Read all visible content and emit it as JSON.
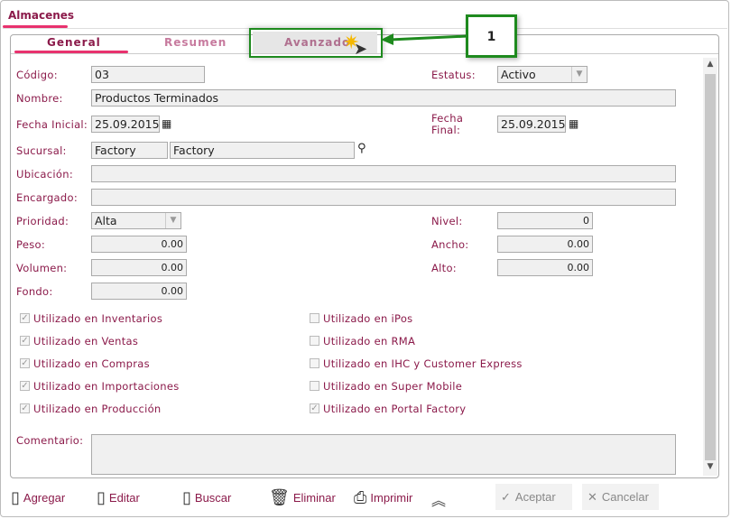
{
  "window_tab": "Almacenes",
  "tabs": [
    "General",
    "Resumen",
    "Avanzado"
  ],
  "fields": {
    "codigo": {
      "label": "Código:",
      "value": "03"
    },
    "estatus": {
      "label": "Estatus:",
      "value": "Activo"
    },
    "nombre": {
      "label": "Nombre:",
      "value": "Productos Terminados"
    },
    "fecha_inicial": {
      "label": "Fecha Inicial:",
      "value": "25.09.2015"
    },
    "fecha_final": {
      "label1": "Fecha",
      "label2": "Final:",
      "value": "25.09.2015"
    },
    "sucursal": {
      "label": "Sucursal:",
      "value1": "Factory",
      "value2": "Factory"
    },
    "ubicacion": {
      "label": "Ubicación:",
      "value": ""
    },
    "encargado": {
      "label": "Encargado:",
      "value": ""
    },
    "prioridad": {
      "label": "Prioridad:",
      "value": "Alta"
    },
    "nivel": {
      "label": "Nivel:",
      "value": "0"
    },
    "peso": {
      "label": "Peso:",
      "value": "0.00"
    },
    "ancho": {
      "label": "Ancho:",
      "value": "0.00"
    },
    "volumen": {
      "label": "Volumen:",
      "value": "0.00"
    },
    "alto": {
      "label": "Alto:",
      "value": "0.00"
    },
    "fondo": {
      "label": "Fondo:",
      "value": "0.00"
    },
    "comentario": {
      "label": "Comentario:",
      "value": ""
    }
  },
  "checks_left": [
    {
      "label": "Utilizado en Inventarios",
      "checked": true
    },
    {
      "label": "Utilizado en Ventas",
      "checked": true
    },
    {
      "label": "Utilizado en Compras",
      "checked": true
    },
    {
      "label": "Utilizado en Importaciones",
      "checked": true
    },
    {
      "label": "Utilizado en Producción",
      "checked": true
    }
  ],
  "checks_right": [
    {
      "label": "Utilizado en iPos",
      "checked": false
    },
    {
      "label": "Utilizado en RMA",
      "checked": false
    },
    {
      "label": "Utilizado en IHC y Customer Express",
      "checked": false
    },
    {
      "label": "Utilizado en Super Mobile",
      "checked": false
    },
    {
      "label": "Utilizado en Portal Factory",
      "checked": true
    }
  ],
  "toolbar": {
    "agregar": "Agregar",
    "editar": "Editar",
    "buscar": "Buscar",
    "eliminar": "Eliminar",
    "imprimir": "Imprimir",
    "aceptar": "Aceptar",
    "cancelar": "Cancelar"
  },
  "callout": "1"
}
